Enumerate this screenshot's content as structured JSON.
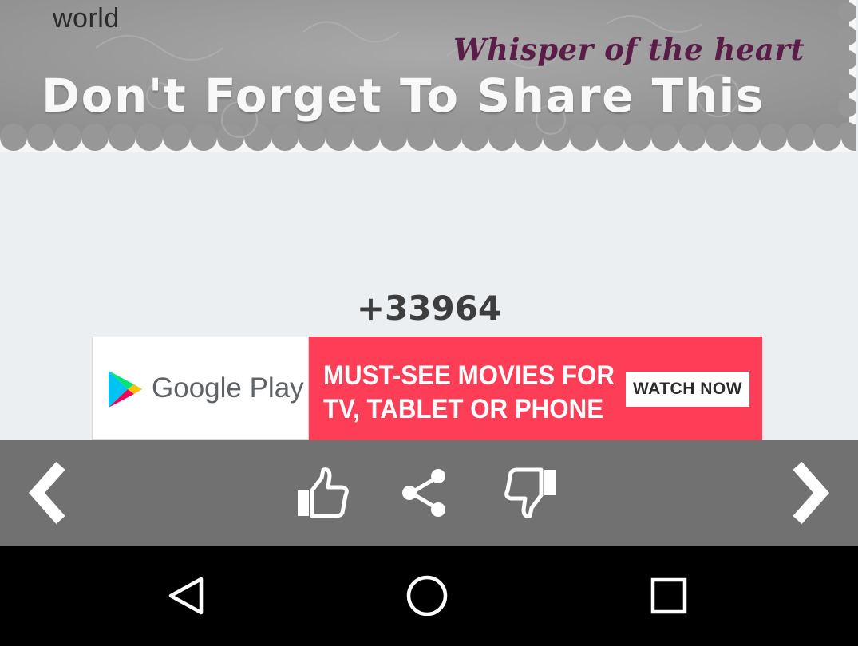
{
  "quote_image": {
    "caption": "world",
    "title": "Whisper of the heart",
    "share_text": "Don't Forget To Share This"
  },
  "likes": {
    "count": "+33964"
  },
  "ad": {
    "brand": "Google Play",
    "headline_line1": "MUST-SEE MOVIES FOR",
    "headline_line2": "TV, TABLET OR PHONE",
    "cta": "WATCH NOW",
    "colors": {
      "background": "#fe3d57",
      "brand_text": "#5f6368"
    }
  },
  "toolbar": {
    "icons": [
      "chevron-left-icon",
      "thumbs-up-icon",
      "share-icon",
      "thumbs-down-icon",
      "chevron-right-icon"
    ],
    "colors": {
      "background": "#717171",
      "icon": "#ffffff"
    }
  },
  "system_nav": {
    "icons": [
      "back-triangle-icon",
      "home-circle-icon",
      "recents-square-icon"
    ],
    "colors": {
      "background": "#000000",
      "icon": "#ffffff"
    }
  }
}
